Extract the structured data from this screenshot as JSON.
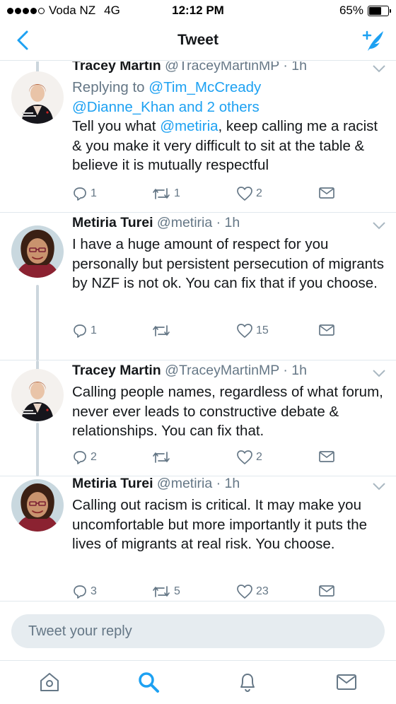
{
  "status_bar": {
    "carrier": "Voda NZ",
    "network": "4G",
    "time": "12:12 PM",
    "battery_percent": "65%",
    "battery_level": 0.65,
    "signal_bars": 4
  },
  "nav": {
    "title": "Tweet",
    "back_icon": "chevron-left-icon",
    "compose_icon": "compose-tweet-icon"
  },
  "colors": {
    "accent": "#1da1f2",
    "secondary_text": "#657786",
    "divider": "#e1e8ed",
    "thread_line": "#ccd6dd"
  },
  "tweets": [
    {
      "name": "Tracey Martin",
      "meta": "@TraceyMartinMP · 1h",
      "reply_prefix": "Replying to ",
      "reply_handle1": "@Tim_McCready",
      "reply_handle2": "@Dianne_Khan and 2 others",
      "text_before": "Tell you what ",
      "mention": "@metiria",
      "text_after": ", keep calling me a racist & you make it very difficult to sit at the table & believe it is mutually respectful",
      "replies": "1",
      "retweets": "1",
      "likes": "2"
    },
    {
      "name": "Metiria Turei",
      "meta": "@metiria · 1h",
      "text": "I have a huge amount of respect for you personally but persistent persecution of migrants by NZF is not ok. You can fix that if you choose.",
      "replies": "1",
      "retweets": "",
      "likes": "15"
    },
    {
      "name": "Tracey Martin",
      "meta": "@TraceyMartinMP · 1h",
      "text": "Calling people names, regardless of what forum, never ever leads to constructive debate & relationships. You can fix that.",
      "replies": "2",
      "retweets": "",
      "likes": "2"
    },
    {
      "name": "Metiria Turei",
      "meta": "@metiria · 1h",
      "text": "Calling out racism is critical. It may make you uncomfortable but more importantly it puts the lives of migrants at real risk. You choose.",
      "replies": "3",
      "retweets": "5",
      "likes": "23"
    }
  ],
  "reply_box": {
    "placeholder": "Tweet your reply"
  },
  "tab_bar": {
    "items": [
      "home-icon",
      "search-icon",
      "notifications-icon",
      "messages-icon"
    ],
    "active": "search-icon"
  }
}
